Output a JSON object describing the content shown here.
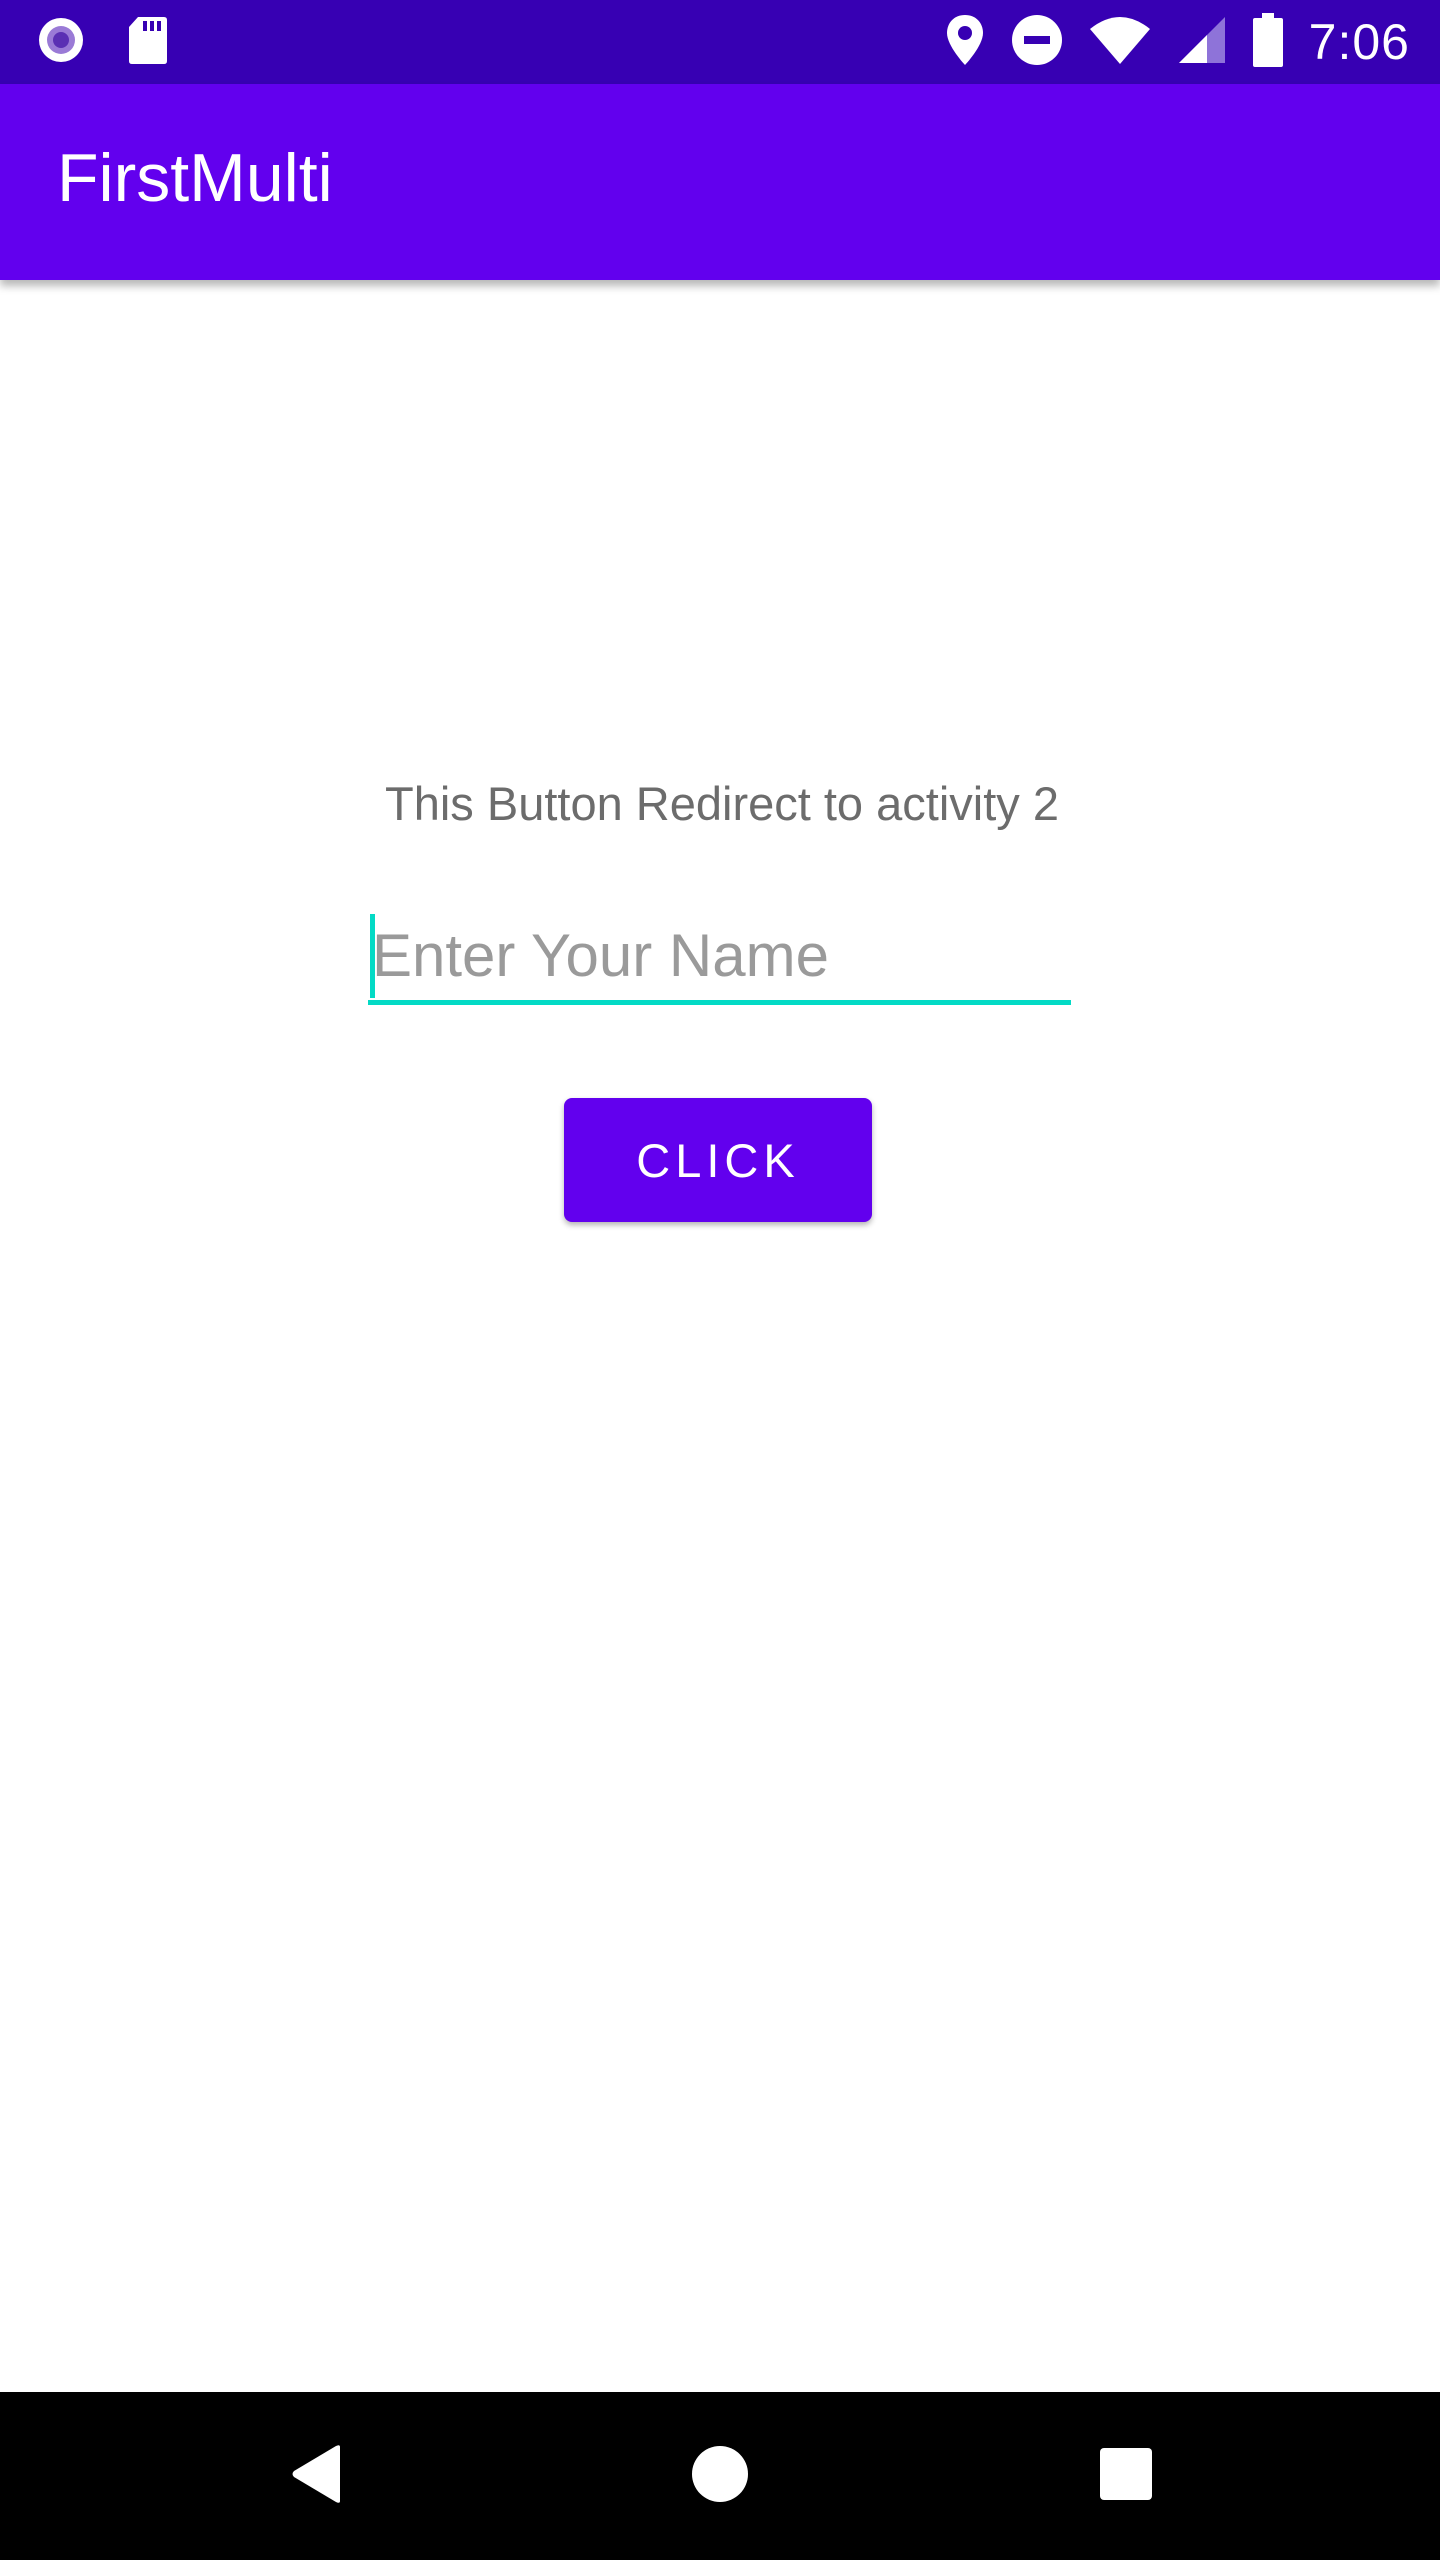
{
  "status_bar": {
    "time": "7:06",
    "left_icons": [
      "notification-circle-icon",
      "sd-card-icon"
    ],
    "right_icons": [
      "location-pin-icon",
      "do-not-disturb-icon",
      "wifi-icon",
      "cell-signal-icon",
      "battery-icon"
    ]
  },
  "app_bar": {
    "title": "FirstMulti"
  },
  "main": {
    "info_text": "This Button Redirect to activity 2",
    "name_input": {
      "placeholder": "Enter Your Name",
      "value": ""
    },
    "button_label": "CLICK"
  },
  "nav_bar": {
    "icons": [
      "back-icon",
      "home-icon",
      "recents-icon"
    ]
  },
  "colors": {
    "status_bar": "#3700b3",
    "primary": "#6200ee",
    "accent": "#03dac5",
    "nav_bar": "#000000"
  }
}
